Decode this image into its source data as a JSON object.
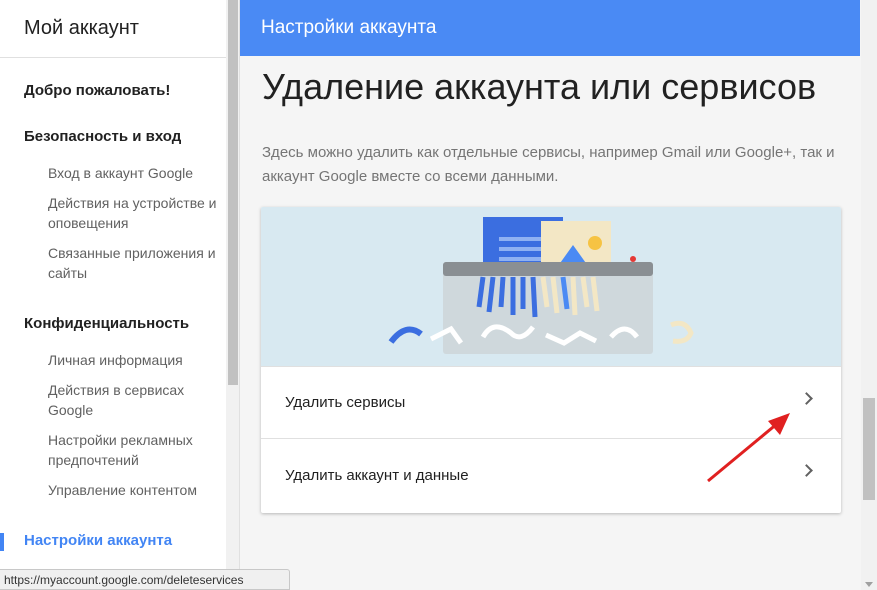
{
  "sidebar": {
    "title": "Мой аккаунт",
    "welcome": "Добро пожаловать!",
    "security": {
      "label": "Безопасность и вход",
      "items": [
        "Вход в аккаунт Google",
        "Действия на устройстве и оповещения",
        "Связанные приложения и сайты"
      ]
    },
    "privacy": {
      "label": "Конфиденциальность",
      "items": [
        "Личная информация",
        "Действия в сервисах Google",
        "Настройки рекламных предпочтений",
        "Управление контентом"
      ]
    },
    "account_settings": "Настройки аккаунта"
  },
  "appbar": {
    "title": "Настройки аккаунта"
  },
  "main": {
    "heading": "Удаление аккаунта или сервисов",
    "description": "Здесь можно удалить как отдельные сервисы, например Gmail или Google+, так и аккаунт Google вместе со всеми данными.",
    "options": [
      "Удалить сервисы",
      "Удалить аккаунт и данные"
    ]
  },
  "status_bar": {
    "url": "https://myaccount.google.com/deleteservices"
  },
  "colors": {
    "accent": "#4285f4",
    "appbar": "#4a8af4",
    "annotation_arrow": "#e02020"
  }
}
